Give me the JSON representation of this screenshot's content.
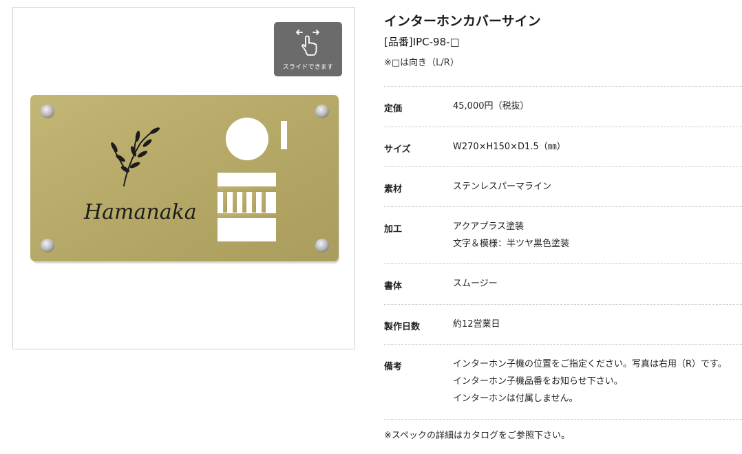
{
  "viewer": {
    "slide_hint": "スライドできます",
    "plate": {
      "name_text": "Hamanaka",
      "plate_color": "#b9ab6a",
      "screw_color": "#c8c8c8"
    },
    "icon": "swipe-hand-icon"
  },
  "product": {
    "title": "インターホンカバーサイン",
    "code": "[品番]IPC-98-□",
    "note": "※□は向き（L/R）"
  },
  "specs": [
    {
      "label": "定価",
      "values": [
        "45,000円（税抜）"
      ]
    },
    {
      "label": "サイズ",
      "values": [
        "W270×H150×D1.5（㎜）"
      ]
    },
    {
      "label": "素材",
      "values": [
        "ステンレスパーマライン"
      ]
    },
    {
      "label": "加工",
      "values": [
        "アクアプラス塗装",
        "文字＆模様：半ツヤ黒色塗装"
      ]
    },
    {
      "label": "書体",
      "values": [
        "スムージー"
      ]
    },
    {
      "label": "製作日数",
      "values": [
        "約12営業日"
      ]
    },
    {
      "label": "備考",
      "values": [
        "インターホン子機の位置をご指定ください。写真は右用（R）です。",
        "インターホン子機品番をお知らせ下さい。",
        "インターホンは付属しません。"
      ]
    }
  ],
  "footer_note": "※スペックの詳細はカタログをご参照下さい。"
}
